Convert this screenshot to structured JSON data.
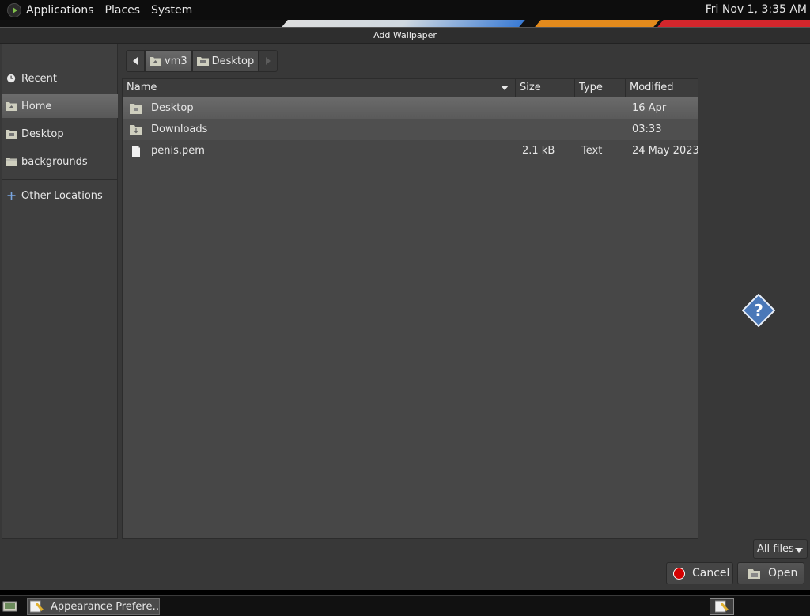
{
  "top_panel": {
    "menus": [
      "Applications",
      "Places",
      "System"
    ],
    "clock": "Fri Nov  1,  3:35 AM"
  },
  "dialog": {
    "title": "Add Wallpaper"
  },
  "sidebar": {
    "items": [
      {
        "label": "Recent",
        "icon": "clock-icon"
      },
      {
        "label": "Home",
        "icon": "home-folder-icon",
        "selected": true
      },
      {
        "label": "Desktop",
        "icon": "desktop-folder-icon"
      },
      {
        "label": "backgrounds",
        "icon": "folder-icon"
      },
      {
        "label": "Other Locations",
        "icon": "plus-icon"
      }
    ]
  },
  "pathbar": {
    "segments": [
      "vm3",
      "Desktop"
    ]
  },
  "file_list": {
    "columns": {
      "name": "Name",
      "size": "Size",
      "type": "Type",
      "modified": "Modified"
    },
    "rows": [
      {
        "name": "Desktop",
        "size": "",
        "type": "",
        "modified": "16 Apr",
        "icon": "folder-icon"
      },
      {
        "name": "Downloads",
        "size": "",
        "type": "",
        "modified": "03:33",
        "icon": "folder-icon"
      },
      {
        "name": "penis.pem",
        "size": "2.1 kB",
        "type": "Text",
        "modified": "24 May 2023",
        "icon": "text-file-icon"
      }
    ]
  },
  "preview": {
    "icon": "help-icon"
  },
  "filter": {
    "selected": "All files"
  },
  "buttons": {
    "cancel": "Cancel",
    "open": "Open"
  },
  "taskbar": {
    "task_label": "Appearance Prefere…"
  },
  "colors": {
    "selection": "#626262",
    "cancel_icon": "#d40000",
    "help_icon": "#4a78b8"
  }
}
